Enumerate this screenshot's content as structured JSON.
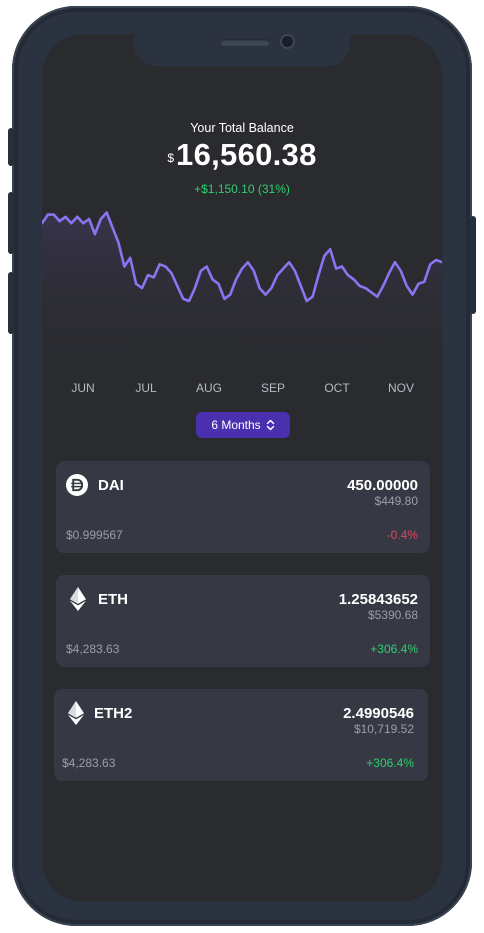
{
  "balance": {
    "label": "Your Total Balance",
    "currency_symbol": "$",
    "amount": "16,560.38",
    "change": "+$1,150.10 (31%)"
  },
  "chart_data": {
    "type": "area",
    "series": [
      {
        "values": [
          92,
          96,
          96,
          93,
          95,
          92,
          95,
          92,
          94,
          87,
          94,
          97,
          90,
          83,
          72,
          76,
          64,
          62,
          68,
          67,
          73,
          72,
          69,
          63,
          57,
          56,
          62,
          70,
          72,
          66,
          64,
          57,
          59,
          66,
          71,
          74,
          70,
          62,
          59,
          62,
          68,
          71,
          74,
          70,
          63,
          56,
          58,
          68,
          77,
          80,
          71,
          72,
          68,
          66,
          63,
          62,
          60,
          58,
          63,
          69,
          74,
          70,
          63,
          59,
          64,
          65,
          73,
          75,
          74
        ]
      }
    ],
    "x_ticks": [
      "JUN",
      "JUL",
      "AUG",
      "SEP",
      "OCT",
      "NOV"
    ],
    "grid": false,
    "colors": {
      "line": "#8b74f0",
      "fill": "#3a3550"
    }
  },
  "range_selector": {
    "label": "6 Months"
  },
  "assets": [
    {
      "symbol": "DAI",
      "icon": "dai-icon",
      "quantity": "450.00000",
      "usd_value": "$449.80",
      "price": "$0.999567",
      "change": "-0.4%",
      "change_color": "#d84a5c"
    },
    {
      "symbol": "ETH",
      "icon": "ethereum-icon",
      "quantity": "1.25843652",
      "usd_value": "$5390.68",
      "price": "$4,283.63",
      "change": "+306.4%",
      "change_color": "#2fcf6f"
    },
    {
      "symbol": "ETH2",
      "icon": "ethereum-icon",
      "quantity": "2.4990546",
      "usd_value": "$10,719.52",
      "price": "$4,283.63",
      "change": "+306.4%",
      "change_color": "#2fcf6f"
    }
  ]
}
